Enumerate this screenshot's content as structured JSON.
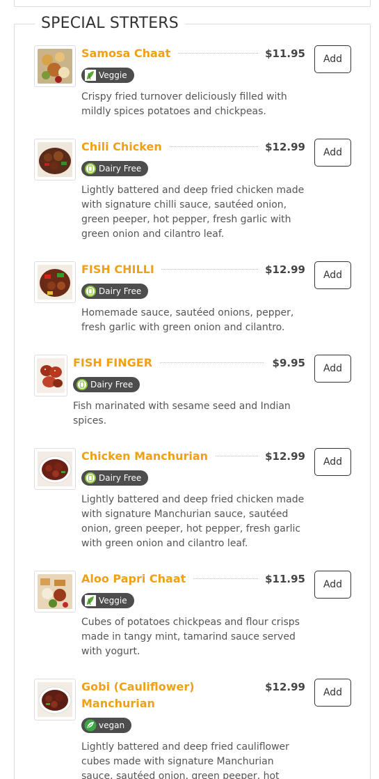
{
  "section": {
    "title": "SPECIAL STRTERS"
  },
  "badges": {
    "veggie": {
      "icon": "leaf-icon",
      "color": "#5aa832"
    },
    "dairy_free": {
      "icon": "dairy-free-icon",
      "color": "#8fc43f"
    },
    "vegan": {
      "icon": "vegan-leaf-icon",
      "color": "#3aa842"
    }
  },
  "colors": {
    "item_name": "#f0a014",
    "badge_bg": "#4d4d4d"
  },
  "items": [
    {
      "name": "Samosa Chaat",
      "price": "$11.95",
      "badge": "Veggie",
      "desc": "Crispy fried turnover deliciously filled with mildly spices potatoes and chickpeas.",
      "add": "Add"
    },
    {
      "name": "Chili Chicken",
      "price": "$12.99",
      "badge": "Dairy Free",
      "desc": "Lightly battered and deep fried chicken made with signature chilli sauce, sautéed onion, green peeper, hot pepper, fresh garlic with green onion and cilantro leaf.",
      "add": "Add"
    },
    {
      "name": "FISH CHILLI",
      "price": "$12.99",
      "badge": "Dairy Free",
      "desc": "Homemade sauce, sautéed onions, pepper, fresh garlic with green onion and cilantro.",
      "add": "Add"
    },
    {
      "name": "FISH FINGER",
      "price": "$9.95",
      "badge": "Dairy Free",
      "desc": "Fish marinated with sesame seed and Indian spices.",
      "add": "Add"
    },
    {
      "name": "Chicken Manchurian",
      "price": "$12.99",
      "badge": "Dairy Free",
      "desc": "Lightly battered and deep fried chicken made with signature Manchurian sauce, sautéed onion, green peeper, hot pepper, fresh garlic with green onion and cilantro leaf.",
      "add": "Add"
    },
    {
      "name": "Aloo Papri Chaat",
      "price": "$11.95",
      "badge": "Veggie",
      "desc": "Cubes of potatoes chickpeas and flour crisps made in tangy mint, tamarind sauce served with yogurt.",
      "add": "Add"
    },
    {
      "name": "Gobi (Cauliflower) Manchurian",
      "price": "$12.99",
      "badge": "vegan",
      "desc": "Lightly battered and deep fried cauliflower cubes made with signature Manchurian sauce, sautéed onion, green peeper, hot pepper, fresh garlic with green onion and cilantro leaf.",
      "add": "Add"
    }
  ]
}
